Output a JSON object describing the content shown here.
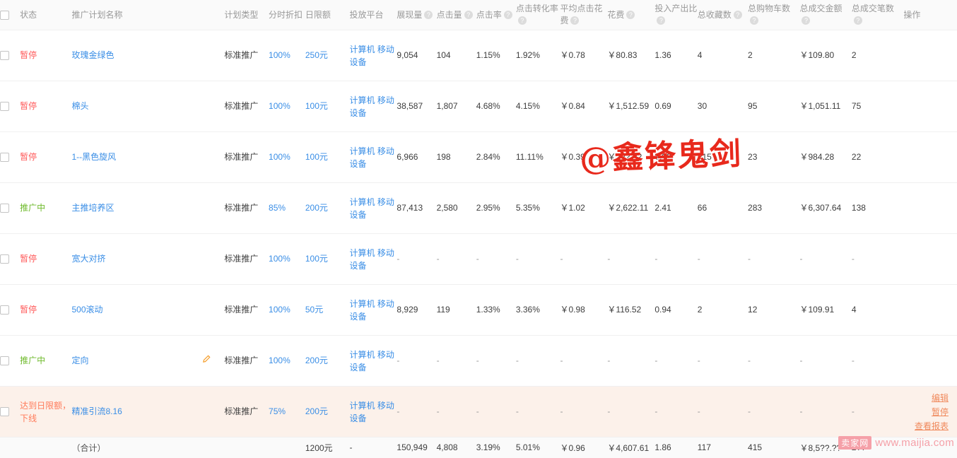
{
  "table": {
    "columns": [
      {
        "key": "checkbox",
        "label": "",
        "help": false
      },
      {
        "key": "status",
        "label": "状态",
        "help": false
      },
      {
        "key": "name",
        "label": "推广计划名称",
        "help": false
      },
      {
        "key": "edit",
        "label": "",
        "help": false
      },
      {
        "key": "type",
        "label": "计划类型",
        "help": false
      },
      {
        "key": "discount",
        "label": "分时折扣",
        "help": false
      },
      {
        "key": "budget",
        "label": "日限额",
        "help": false
      },
      {
        "key": "platform",
        "label": "投放平台",
        "help": false
      },
      {
        "key": "impressions",
        "label": "展现量",
        "help": true
      },
      {
        "key": "clicks",
        "label": "点击量",
        "help": true
      },
      {
        "key": "ctr",
        "label": "点击率",
        "help": true
      },
      {
        "key": "cvr",
        "label": "点击转化率",
        "help": true
      },
      {
        "key": "cpc",
        "label": "平均点击花费",
        "help": true
      },
      {
        "key": "cost",
        "label": "花费",
        "help": true
      },
      {
        "key": "roi",
        "label": "投入产出比",
        "help": true
      },
      {
        "key": "favorites",
        "label": "总收藏数",
        "help": true
      },
      {
        "key": "carts",
        "label": "总购物车数",
        "help": true
      },
      {
        "key": "amount",
        "label": "总成交金额",
        "help": true
      },
      {
        "key": "orders",
        "label": "总成交笔数",
        "help": true
      },
      {
        "key": "ops",
        "label": "操作",
        "help": false
      }
    ],
    "help_glyph": "?",
    "rows": [
      {
        "status": "暂停",
        "status_kind": "paused",
        "name": "玫瑰金绿色",
        "has_edit_pencil": false,
        "type": "标准推广",
        "discount": "100%",
        "budget": "250元",
        "platform": "计算机 移动设备",
        "impressions": "9,054",
        "clicks": "104",
        "ctr": "1.15%",
        "cvr": "1.92%",
        "cpc": "￥0.78",
        "cost": "￥80.83",
        "roi": "1.36",
        "favorites": "4",
        "carts": "2",
        "amount": "￥109.80",
        "orders": "2",
        "highlight": false,
        "ops": []
      },
      {
        "status": "暂停",
        "status_kind": "paused",
        "name": "棉头",
        "has_edit_pencil": false,
        "type": "标准推广",
        "discount": "100%",
        "budget": "100元",
        "platform": "计算机 移动设备",
        "impressions": "38,587",
        "clicks": "1,807",
        "ctr": "4.68%",
        "cvr": "4.15%",
        "cpc": "￥0.84",
        "cost": "￥1,512.59",
        "roi": "0.69",
        "favorites": "30",
        "carts": "95",
        "amount": "￥1,051.11",
        "orders": "75",
        "highlight": false,
        "ops": []
      },
      {
        "status": "暂停",
        "status_kind": "paused",
        "name": "1--黑色旋风",
        "has_edit_pencil": false,
        "type": "标准推广",
        "discount": "100%",
        "budget": "100元",
        "platform": "计算机 移动设备",
        "impressions": "6,966",
        "clicks": "198",
        "ctr": "2.84%",
        "cvr": "11.11%",
        "cpc": "￥0.39",
        "cost": "￥2??.??",
        "roi": "?.??",
        "favorites": "?15",
        "carts": "23",
        "amount": "￥984.28",
        "orders": "22",
        "highlight": false,
        "ops": []
      },
      {
        "status": "推广中",
        "status_kind": "running",
        "name": "主推培养区",
        "has_edit_pencil": false,
        "type": "标准推广",
        "discount": "85%",
        "budget": "200元",
        "platform": "计算机 移动设备",
        "impressions": "87,413",
        "clicks": "2,580",
        "ctr": "2.95%",
        "cvr": "5.35%",
        "cpc": "￥1.02",
        "cost": "￥2,622.11",
        "roi": "2.41",
        "favorites": "66",
        "carts": "283",
        "amount": "￥6,307.64",
        "orders": "138",
        "highlight": false,
        "ops": []
      },
      {
        "status": "暂停",
        "status_kind": "paused",
        "name": "宽大对挤",
        "has_edit_pencil": false,
        "type": "标准推广",
        "discount": "100%",
        "budget": "100元",
        "platform": "计算机 移动设备",
        "impressions": "-",
        "clicks": "-",
        "ctr": "-",
        "cvr": "-",
        "cpc": "-",
        "cost": "-",
        "roi": "-",
        "favorites": "-",
        "carts": "-",
        "amount": "-",
        "orders": "-",
        "highlight": false,
        "ops": []
      },
      {
        "status": "暂停",
        "status_kind": "paused",
        "name": "500滚动",
        "has_edit_pencil": false,
        "type": "标准推广",
        "discount": "100%",
        "budget": "50元",
        "platform": "计算机 移动设备",
        "impressions": "8,929",
        "clicks": "119",
        "ctr": "1.33%",
        "cvr": "3.36%",
        "cpc": "￥0.98",
        "cost": "￥116.52",
        "roi": "0.94",
        "favorites": "2",
        "carts": "12",
        "amount": "￥109.91",
        "orders": "4",
        "highlight": false,
        "ops": []
      },
      {
        "status": "推广中",
        "status_kind": "running",
        "name": "定向",
        "has_edit_pencil": true,
        "type": "标准推广",
        "discount": "100%",
        "budget": "200元",
        "platform": "计算机 移动设备",
        "impressions": "-",
        "clicks": "-",
        "ctr": "-",
        "cvr": "-",
        "cpc": "-",
        "cost": "-",
        "roi": "-",
        "favorites": "-",
        "carts": "-",
        "amount": "-",
        "orders": "-",
        "highlight": false,
        "ops": []
      },
      {
        "status": "达到日限额，下线",
        "status_kind": "limit",
        "name": "精准引流8.16",
        "has_edit_pencil": false,
        "type": "标准推广",
        "discount": "75%",
        "budget": "200元",
        "platform": "计算机 移动设备",
        "impressions": "-",
        "clicks": "-",
        "ctr": "-",
        "cvr": "-",
        "cpc": "-",
        "cost": "-",
        "roi": "-",
        "favorites": "-",
        "carts": "-",
        "amount": "-",
        "orders": "-",
        "highlight": true,
        "ops": [
          "编辑",
          "暂停",
          "查看报表"
        ]
      }
    ],
    "total": {
      "label": "（合计）",
      "budget": "1200元",
      "platform": "-",
      "impressions": "150,949",
      "clicks": "4,808",
      "ctr": "3.19%",
      "cvr": "5.01%",
      "cpc": "￥0.96",
      "cost": "￥4,607.61",
      "roi": "1.86",
      "favorites": "117",
      "carts": "415",
      "amount": "￥8,5??.??",
      "orders": "2??"
    }
  },
  "watermarks": {
    "author": "@鑫锋鬼剑",
    "site_badge": "卖家网",
    "site_url": "www.maijia.com"
  },
  "colors": {
    "link": "#3a8ee6",
    "paused": "#ff5b5b",
    "running": "#6fba2c",
    "limit": "#ff7a59",
    "ops_link": "#f08a5d",
    "highlight_bg": "#fcf1ea",
    "header_bg": "#fafafa",
    "watermark_red": "#e8291c",
    "watermark_pink": "#f5a0a8"
  }
}
